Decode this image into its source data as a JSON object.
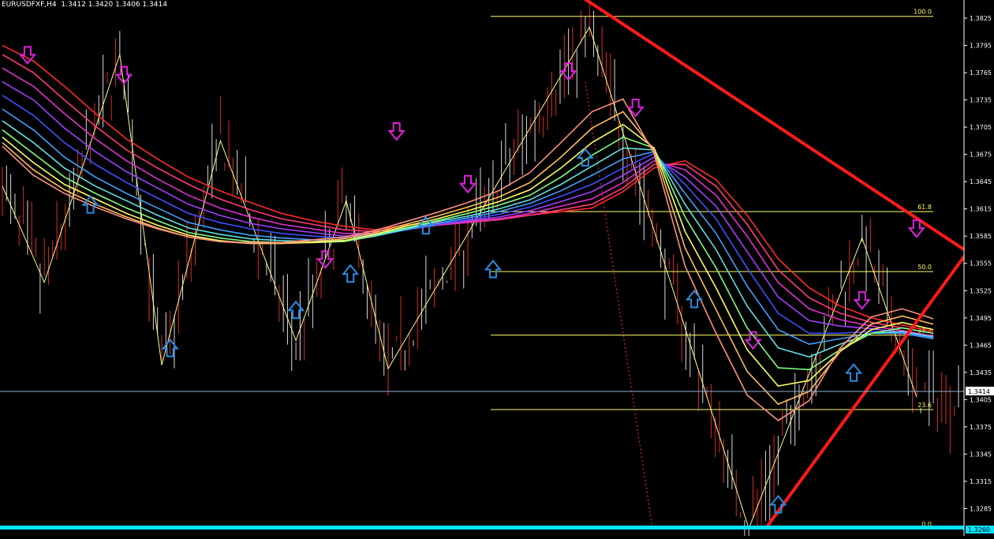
{
  "window": {
    "symbol": "EURUSDFXF,H4",
    "ohlc": "1.3412 1.3420 1.3406 1.3414"
  },
  "colors": {
    "background": "#000000",
    "axis": "#ffffff",
    "fib": "#ffff66",
    "trend": "#ff1a1a",
    "bid_line": "#8ab4d8",
    "bottom_band": "#00e5ff",
    "arrow_down": "#e020e0",
    "arrow_up": "#2a8ae0",
    "candle": "#ff3333",
    "candle_up": "#ffffff",
    "zigzag": "#ffff88"
  },
  "chart_data": {
    "type": "line",
    "title": "EURUSDFXF,H4",
    "y_axis": {
      "range": [
        1.3255,
        1.3845
      ],
      "ticks": [
        "1.3825",
        "1.3795",
        "1.3765",
        "1.3735",
        "1.3705",
        "1.3675",
        "1.3645",
        "1.3615",
        "1.3585",
        "1.3555",
        "1.3525",
        "1.3495",
        "1.3465",
        "1.3435",
        "1.3405",
        "1.3375",
        "1.3345",
        "1.3315",
        "1.3285"
      ]
    },
    "current_price": "1.3414",
    "bottom_price": "1.3260",
    "fibonacci": [
      {
        "label": "100.0",
        "price": 1.3827
      },
      {
        "label": "61.8",
        "price": 1.3612
      },
      {
        "label": "50.0",
        "price": 1.3546
      },
      {
        "label": "38.2",
        "price": 1.3476
      },
      {
        "label": "23.6",
        "price": 1.3394
      },
      {
        "label": "0.0",
        "price": 1.3263
      }
    ],
    "zigzag": [
      {
        "bar": 0,
        "price": 1.364
      },
      {
        "bar": 10,
        "price": 1.3534
      },
      {
        "bar": 28,
        "price": 1.3785
      },
      {
        "bar": 38,
        "price": 1.3443
      },
      {
        "bar": 52,
        "price": 1.369
      },
      {
        "bar": 70,
        "price": 1.347
      },
      {
        "bar": 82,
        "price": 1.3624
      },
      {
        "bar": 92,
        "price": 1.3439
      },
      {
        "bar": 140,
        "price": 1.3815
      },
      {
        "bar": 178,
        "price": 1.3263
      },
      {
        "bar": 205,
        "price": 1.3583
      },
      {
        "bar": 218,
        "price": 1.3408
      }
    ],
    "ribbon": [
      {
        "color": "#ff2a2a",
        "values": [
          1.3795,
          1.3778,
          1.375,
          1.372,
          1.3692,
          1.367,
          1.365,
          1.3635,
          1.3622,
          1.361,
          1.3602,
          1.3596,
          1.3592,
          1.3597,
          1.36,
          1.3601,
          1.3604,
          1.3608,
          1.3612,
          1.3616,
          1.3634,
          1.366,
          1.3668,
          1.3647,
          1.3608,
          1.356,
          1.3528,
          1.3508,
          1.3495,
          1.3487,
          1.348
        ]
      },
      {
        "color": "#ff3a7a",
        "values": [
          1.3785,
          1.3765,
          1.3735,
          1.3706,
          1.368,
          1.366,
          1.3642,
          1.3626,
          1.3614,
          1.3604,
          1.3598,
          1.3592,
          1.359,
          1.3594,
          1.3598,
          1.36,
          1.3603,
          1.3608,
          1.3614,
          1.362,
          1.3638,
          1.3664,
          1.3664,
          1.364,
          1.3598,
          1.3548,
          1.3517,
          1.35,
          1.349,
          1.3484,
          1.3478
        ]
      },
      {
        "color": "#e030d0",
        "values": [
          1.377,
          1.375,
          1.372,
          1.3692,
          1.3668,
          1.3648,
          1.363,
          1.3616,
          1.3606,
          1.3598,
          1.3593,
          1.3588,
          1.3588,
          1.3592,
          1.3597,
          1.36,
          1.3604,
          1.361,
          1.3618,
          1.3626,
          1.3644,
          1.3668,
          1.3658,
          1.363,
          1.3585,
          1.3534,
          1.3505,
          1.3493,
          1.3486,
          1.3481,
          1.3475
        ]
      },
      {
        "color": "#a040ff",
        "values": [
          1.3755,
          1.3735,
          1.3704,
          1.3678,
          1.3656,
          1.3638,
          1.362,
          1.3608,
          1.3599,
          1.3593,
          1.3589,
          1.3585,
          1.3587,
          1.3592,
          1.3598,
          1.3602,
          1.3606,
          1.3613,
          1.3623,
          1.3634,
          1.3652,
          1.3672,
          1.365,
          1.3618,
          1.3568,
          1.3518,
          1.3492,
          1.3486,
          1.3483,
          1.3479,
          1.3474
        ]
      },
      {
        "color": "#4050ff",
        "values": [
          1.374,
          1.3718,
          1.3688,
          1.3664,
          1.3644,
          1.3627,
          1.361,
          1.36,
          1.3593,
          1.3588,
          1.3585,
          1.3583,
          1.3586,
          1.3592,
          1.3598,
          1.3603,
          1.3609,
          1.3617,
          1.3629,
          1.3642,
          1.366,
          1.3676,
          1.3642,
          1.3604,
          1.355,
          1.35,
          1.3478,
          1.3478,
          1.348,
          1.3478,
          1.3473
        ]
      },
      {
        "color": "#40a0ff",
        "values": [
          1.3725,
          1.3702,
          1.3672,
          1.365,
          1.3632,
          1.3616,
          1.36,
          1.3592,
          1.3586,
          1.3583,
          1.3581,
          1.358,
          1.3585,
          1.3592,
          1.3599,
          1.3605,
          1.3612,
          1.3621,
          1.3635,
          1.3652,
          1.367,
          1.3678,
          1.3632,
          1.3588,
          1.353,
          1.3482,
          1.3466,
          1.3472,
          1.3478,
          1.3478,
          1.3472
        ]
      },
      {
        "color": "#60e0e0",
        "values": [
          1.3712,
          1.3688,
          1.366,
          1.364,
          1.3624,
          1.3608,
          1.3594,
          1.3587,
          1.3582,
          1.358,
          1.3579,
          1.3579,
          1.3585,
          1.3593,
          1.3601,
          1.3607,
          1.3615,
          1.3625,
          1.3642,
          1.3662,
          1.3682,
          1.368,
          1.362,
          1.357,
          1.3508,
          1.3462,
          1.3452,
          1.3466,
          1.3478,
          1.348,
          1.3474
        ]
      },
      {
        "color": "#80ff80",
        "values": [
          1.3702,
          1.3676,
          1.365,
          1.3632,
          1.3616,
          1.3602,
          1.3589,
          1.3583,
          1.3579,
          1.3578,
          1.3578,
          1.3579,
          1.3586,
          1.3594,
          1.3602,
          1.361,
          1.3619,
          1.363,
          1.365,
          1.3674,
          1.3694,
          1.3682,
          1.3606,
          1.355,
          1.3484,
          1.344,
          1.3438,
          1.346,
          1.3478,
          1.3484,
          1.3478
        ]
      },
      {
        "color": "#ffff60",
        "values": [
          1.3694,
          1.3666,
          1.3642,
          1.3626,
          1.361,
          1.3597,
          1.3586,
          1.358,
          1.3577,
          1.3577,
          1.3578,
          1.358,
          1.3587,
          1.3596,
          1.3604,
          1.3613,
          1.3623,
          1.3636,
          1.366,
          1.3688,
          1.3708,
          1.3682,
          1.359,
          1.3528,
          1.346,
          1.342,
          1.3426,
          1.3458,
          1.3482,
          1.349,
          1.3482
        ]
      },
      {
        "color": "#ffc060",
        "values": [
          1.3688,
          1.3658,
          1.3636,
          1.362,
          1.3606,
          1.3594,
          1.3584,
          1.3579,
          1.3577,
          1.3577,
          1.3579,
          1.3582,
          1.3589,
          1.3598,
          1.3607,
          1.3617,
          1.3628,
          1.3644,
          1.3672,
          1.3704,
          1.3722,
          1.368,
          1.3572,
          1.3504,
          1.3436,
          1.34,
          1.3414,
          1.3458,
          1.3488,
          1.3497,
          1.3488
        ]
      },
      {
        "color": "#ff9080",
        "values": [
          1.3684,
          1.3652,
          1.3632,
          1.3617,
          1.3604,
          1.3593,
          1.3584,
          1.3579,
          1.3578,
          1.3578,
          1.3581,
          1.3584,
          1.3591,
          1.3601,
          1.3611,
          1.3622,
          1.3635,
          1.3655,
          1.3688,
          1.3722,
          1.3736,
          1.3676,
          1.3552,
          1.3478,
          1.341,
          1.3382,
          1.3404,
          1.3462,
          1.3496,
          1.3505,
          1.3494
        ]
      }
    ],
    "arrows_down": [
      {
        "bar": 6,
        "price": 1.3783
      },
      {
        "bar": 29,
        "price": 1.3761
      },
      {
        "bar": 94,
        "price": 1.3699
      },
      {
        "bar": 77,
        "price": 1.3558
      },
      {
        "bar": 111,
        "price": 1.3641
      },
      {
        "bar": 135,
        "price": 1.3765
      },
      {
        "bar": 151,
        "price": 1.3725
      },
      {
        "bar": 179,
        "price": 1.3469
      },
      {
        "bar": 205,
        "price": 1.3513
      },
      {
        "bar": 218,
        "price": 1.3592
      }
    ],
    "arrows_up": [
      {
        "bar": 21,
        "price": 1.3621
      },
      {
        "bar": 40,
        "price": 1.3463
      },
      {
        "bar": 70,
        "price": 1.3505
      },
      {
        "bar": 83,
        "price": 1.3545
      },
      {
        "bar": 101,
        "price": 1.3598
      },
      {
        "bar": 117,
        "price": 1.355
      },
      {
        "bar": 139,
        "price": 1.3673
      },
      {
        "bar": 165,
        "price": 1.3517
      },
      {
        "bar": 185,
        "price": 1.3291
      },
      {
        "bar": 203,
        "price": 1.3436
      }
    ],
    "trendlines": [
      {
        "from": {
          "bar": 136,
          "price": 1.3855
        },
        "to": {
          "bar": 291,
          "price": 1.3382
        }
      },
      {
        "from": {
          "bar": 182,
          "price": 1.3263
        },
        "to": {
          "bar": 274,
          "price": 1.3845
        }
      }
    ],
    "bars": 229
  }
}
